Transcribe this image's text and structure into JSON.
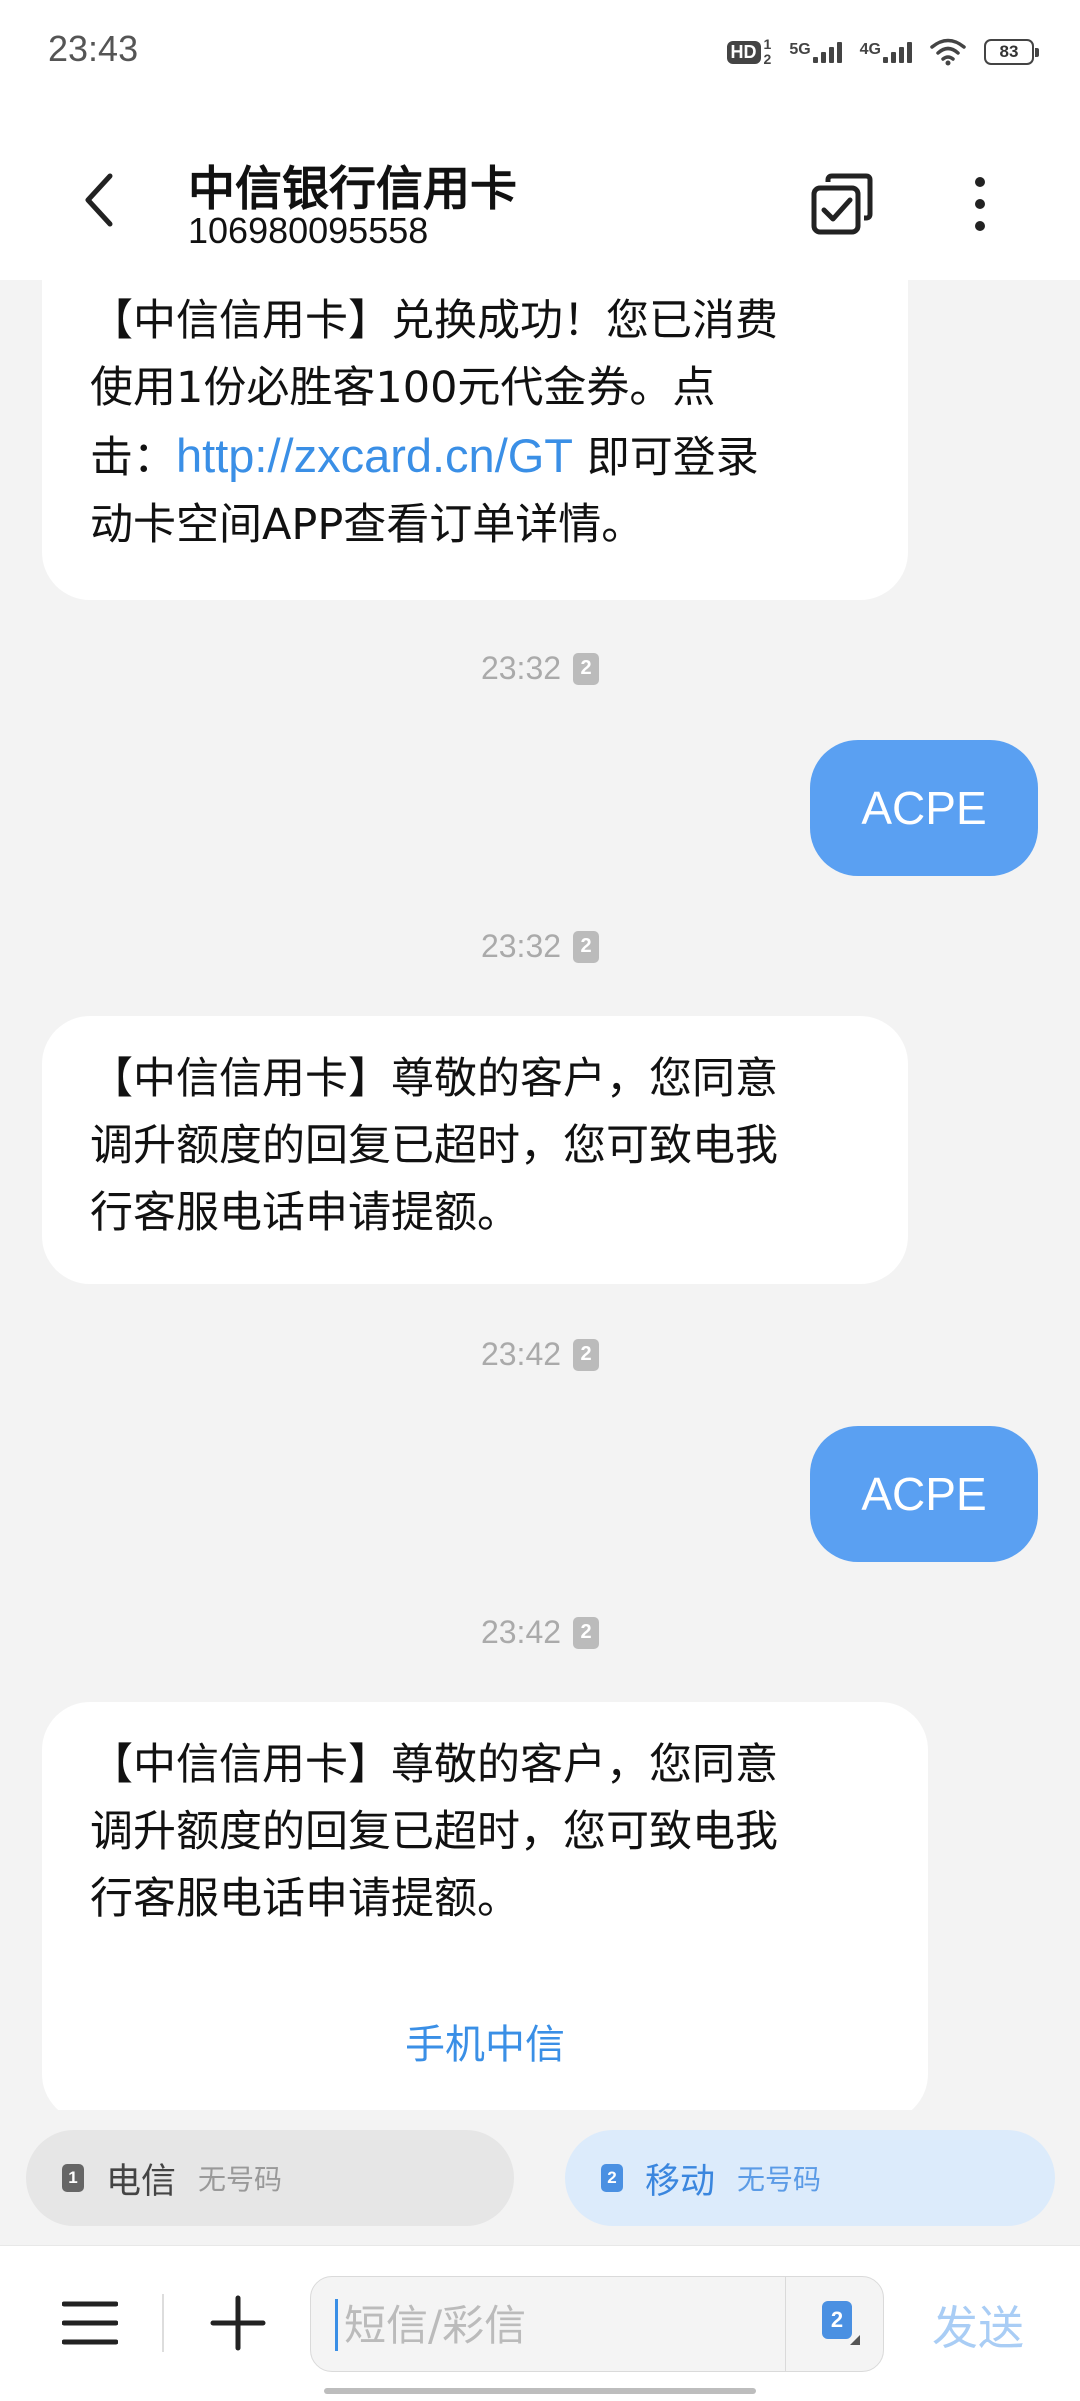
{
  "status_bar": {
    "time": "23:43",
    "hd_label": "HD",
    "sim_labels": [
      "1",
      "2"
    ],
    "sig1_label": "5G",
    "sig2_label": "4G",
    "battery": "83"
  },
  "header": {
    "contact_name": "中信银行信用卡",
    "contact_number": "106980095558"
  },
  "messages": [
    {
      "dir": "in",
      "lines": [
        "【中信信用卡】兑换成功！您已消费",
        "使用1份必胜客100元代金券。点"
      ],
      "line3_prefix": "击：",
      "link": "http://zxcard.cn/GT",
      "line3_suffix": " 即可登录",
      "line4": "动卡空间APP查看订单详情。"
    },
    {
      "dir": "time",
      "text": "23:32",
      "sim": "2"
    },
    {
      "dir": "out",
      "text": "ACPE"
    },
    {
      "dir": "time",
      "text": "23:32",
      "sim": "2"
    },
    {
      "dir": "in",
      "lines": [
        "【中信信用卡】尊敬的客户，您同意",
        "调升额度的回复已超时，您可致电我",
        "行客服电话申请提额。"
      ]
    },
    {
      "dir": "time",
      "text": "23:42",
      "sim": "2"
    },
    {
      "dir": "out",
      "text": "ACPE"
    },
    {
      "dir": "time",
      "text": "23:42",
      "sim": "2"
    },
    {
      "dir": "in",
      "lines": [
        "【中信信用卡】尊敬的客户，您同意",
        "调升额度的回复已超时，您可致电我",
        "行客服电话申请提额。"
      ],
      "service_link": "手机中信"
    }
  ],
  "sim_selector": [
    {
      "slot": "1",
      "carrier": "电信",
      "number": "无号码"
    },
    {
      "slot": "2",
      "carrier": "移动",
      "number": "无号码"
    }
  ],
  "compose": {
    "placeholder": "短信/彩信",
    "sim_slot": "2",
    "send_label": "发送"
  },
  "colors": {
    "outgoing_bubble": "#5aa0f2",
    "link": "#3a8fe6",
    "send_disabled": "#a9cdf5"
  }
}
